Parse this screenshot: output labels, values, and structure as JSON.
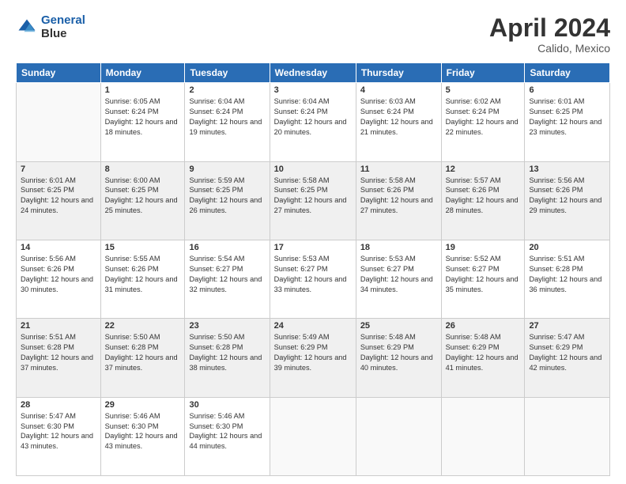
{
  "logo": {
    "line1": "General",
    "line2": "Blue"
  },
  "header": {
    "month": "April 2024",
    "location": "Calido, Mexico"
  },
  "days_of_week": [
    "Sunday",
    "Monday",
    "Tuesday",
    "Wednesday",
    "Thursday",
    "Friday",
    "Saturday"
  ],
  "weeks": [
    [
      {
        "num": "",
        "sunrise": "",
        "sunset": "",
        "daylight": ""
      },
      {
        "num": "1",
        "sunrise": "Sunrise: 6:05 AM",
        "sunset": "Sunset: 6:24 PM",
        "daylight": "Daylight: 12 hours and 18 minutes."
      },
      {
        "num": "2",
        "sunrise": "Sunrise: 6:04 AM",
        "sunset": "Sunset: 6:24 PM",
        "daylight": "Daylight: 12 hours and 19 minutes."
      },
      {
        "num": "3",
        "sunrise": "Sunrise: 6:04 AM",
        "sunset": "Sunset: 6:24 PM",
        "daylight": "Daylight: 12 hours and 20 minutes."
      },
      {
        "num": "4",
        "sunrise": "Sunrise: 6:03 AM",
        "sunset": "Sunset: 6:24 PM",
        "daylight": "Daylight: 12 hours and 21 minutes."
      },
      {
        "num": "5",
        "sunrise": "Sunrise: 6:02 AM",
        "sunset": "Sunset: 6:24 PM",
        "daylight": "Daylight: 12 hours and 22 minutes."
      },
      {
        "num": "6",
        "sunrise": "Sunrise: 6:01 AM",
        "sunset": "Sunset: 6:25 PM",
        "daylight": "Daylight: 12 hours and 23 minutes."
      }
    ],
    [
      {
        "num": "7",
        "sunrise": "Sunrise: 6:01 AM",
        "sunset": "Sunset: 6:25 PM",
        "daylight": "Daylight: 12 hours and 24 minutes."
      },
      {
        "num": "8",
        "sunrise": "Sunrise: 6:00 AM",
        "sunset": "Sunset: 6:25 PM",
        "daylight": "Daylight: 12 hours and 25 minutes."
      },
      {
        "num": "9",
        "sunrise": "Sunrise: 5:59 AM",
        "sunset": "Sunset: 6:25 PM",
        "daylight": "Daylight: 12 hours and 26 minutes."
      },
      {
        "num": "10",
        "sunrise": "Sunrise: 5:58 AM",
        "sunset": "Sunset: 6:25 PM",
        "daylight": "Daylight: 12 hours and 27 minutes."
      },
      {
        "num": "11",
        "sunrise": "Sunrise: 5:58 AM",
        "sunset": "Sunset: 6:26 PM",
        "daylight": "Daylight: 12 hours and 27 minutes."
      },
      {
        "num": "12",
        "sunrise": "Sunrise: 5:57 AM",
        "sunset": "Sunset: 6:26 PM",
        "daylight": "Daylight: 12 hours and 28 minutes."
      },
      {
        "num": "13",
        "sunrise": "Sunrise: 5:56 AM",
        "sunset": "Sunset: 6:26 PM",
        "daylight": "Daylight: 12 hours and 29 minutes."
      }
    ],
    [
      {
        "num": "14",
        "sunrise": "Sunrise: 5:56 AM",
        "sunset": "Sunset: 6:26 PM",
        "daylight": "Daylight: 12 hours and 30 minutes."
      },
      {
        "num": "15",
        "sunrise": "Sunrise: 5:55 AM",
        "sunset": "Sunset: 6:26 PM",
        "daylight": "Daylight: 12 hours and 31 minutes."
      },
      {
        "num": "16",
        "sunrise": "Sunrise: 5:54 AM",
        "sunset": "Sunset: 6:27 PM",
        "daylight": "Daylight: 12 hours and 32 minutes."
      },
      {
        "num": "17",
        "sunrise": "Sunrise: 5:53 AM",
        "sunset": "Sunset: 6:27 PM",
        "daylight": "Daylight: 12 hours and 33 minutes."
      },
      {
        "num": "18",
        "sunrise": "Sunrise: 5:53 AM",
        "sunset": "Sunset: 6:27 PM",
        "daylight": "Daylight: 12 hours and 34 minutes."
      },
      {
        "num": "19",
        "sunrise": "Sunrise: 5:52 AM",
        "sunset": "Sunset: 6:27 PM",
        "daylight": "Daylight: 12 hours and 35 minutes."
      },
      {
        "num": "20",
        "sunrise": "Sunrise: 5:51 AM",
        "sunset": "Sunset: 6:28 PM",
        "daylight": "Daylight: 12 hours and 36 minutes."
      }
    ],
    [
      {
        "num": "21",
        "sunrise": "Sunrise: 5:51 AM",
        "sunset": "Sunset: 6:28 PM",
        "daylight": "Daylight: 12 hours and 37 minutes."
      },
      {
        "num": "22",
        "sunrise": "Sunrise: 5:50 AM",
        "sunset": "Sunset: 6:28 PM",
        "daylight": "Daylight: 12 hours and 37 minutes."
      },
      {
        "num": "23",
        "sunrise": "Sunrise: 5:50 AM",
        "sunset": "Sunset: 6:28 PM",
        "daylight": "Daylight: 12 hours and 38 minutes."
      },
      {
        "num": "24",
        "sunrise": "Sunrise: 5:49 AM",
        "sunset": "Sunset: 6:29 PM",
        "daylight": "Daylight: 12 hours and 39 minutes."
      },
      {
        "num": "25",
        "sunrise": "Sunrise: 5:48 AM",
        "sunset": "Sunset: 6:29 PM",
        "daylight": "Daylight: 12 hours and 40 minutes."
      },
      {
        "num": "26",
        "sunrise": "Sunrise: 5:48 AM",
        "sunset": "Sunset: 6:29 PM",
        "daylight": "Daylight: 12 hours and 41 minutes."
      },
      {
        "num": "27",
        "sunrise": "Sunrise: 5:47 AM",
        "sunset": "Sunset: 6:29 PM",
        "daylight": "Daylight: 12 hours and 42 minutes."
      }
    ],
    [
      {
        "num": "28",
        "sunrise": "Sunrise: 5:47 AM",
        "sunset": "Sunset: 6:30 PM",
        "daylight": "Daylight: 12 hours and 43 minutes."
      },
      {
        "num": "29",
        "sunrise": "Sunrise: 5:46 AM",
        "sunset": "Sunset: 6:30 PM",
        "daylight": "Daylight: 12 hours and 43 minutes."
      },
      {
        "num": "30",
        "sunrise": "Sunrise: 5:46 AM",
        "sunset": "Sunset: 6:30 PM",
        "daylight": "Daylight: 12 hours and 44 minutes."
      },
      {
        "num": "",
        "sunrise": "",
        "sunset": "",
        "daylight": ""
      },
      {
        "num": "",
        "sunrise": "",
        "sunset": "",
        "daylight": ""
      },
      {
        "num": "",
        "sunrise": "",
        "sunset": "",
        "daylight": ""
      },
      {
        "num": "",
        "sunrise": "",
        "sunset": "",
        "daylight": ""
      }
    ]
  ]
}
